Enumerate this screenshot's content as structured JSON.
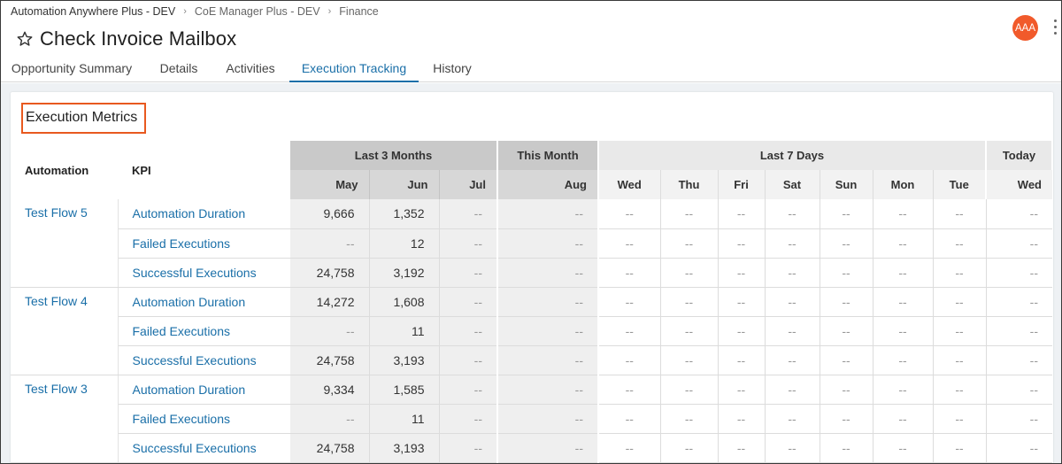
{
  "breadcrumb": [
    "Automation Anywhere Plus - DEV",
    "CoE Manager Plus - DEV",
    "Finance"
  ],
  "title": "Check Invoice Mailbox",
  "user_initials": "AAA",
  "tabs": [
    "Opportunity Summary",
    "Details",
    "Activities",
    "Execution Tracking",
    "History"
  ],
  "active_tab": "Execution Tracking",
  "section_title": "Execution Metrics",
  "columns": {
    "automation": "Automation",
    "kpi": "KPI",
    "group_last3": "Last 3 Months",
    "group_this_month": "This Month",
    "group_last7": "Last 7 Days",
    "group_today": "Today",
    "months": [
      "May",
      "Jun",
      "Jul"
    ],
    "this_month": "Aug",
    "days": [
      "Wed",
      "Thu",
      "Fri",
      "Sat",
      "Sun",
      "Mon",
      "Tue"
    ],
    "today": "Wed"
  },
  "empty": "--",
  "rows": [
    {
      "automation": "Test Flow 5",
      "kpis": [
        {
          "name": "Automation Duration",
          "months": [
            "9,666",
            "1,352",
            "--"
          ]
        },
        {
          "name": "Failed Executions",
          "months": [
            "--",
            "12",
            "--"
          ]
        },
        {
          "name": "Successful Executions",
          "months": [
            "24,758",
            "3,192",
            "--"
          ]
        }
      ]
    },
    {
      "automation": "Test Flow 4",
      "kpis": [
        {
          "name": "Automation Duration",
          "months": [
            "14,272",
            "1,608",
            "--"
          ]
        },
        {
          "name": "Failed Executions",
          "months": [
            "--",
            "11",
            "--"
          ]
        },
        {
          "name": "Successful Executions",
          "months": [
            "24,758",
            "3,193",
            "--"
          ]
        }
      ]
    },
    {
      "automation": "Test Flow 3",
      "kpis": [
        {
          "name": "Automation Duration",
          "months": [
            "9,334",
            "1,585",
            "--"
          ]
        },
        {
          "name": "Failed Executions",
          "months": [
            "--",
            "11",
            "--"
          ]
        },
        {
          "name": "Successful Executions",
          "months": [
            "24,758",
            "3,193",
            "--"
          ]
        }
      ]
    }
  ],
  "colors": {
    "accent": "#1a6fa8",
    "avatar": "#f15a2b",
    "highlight": "#e8591f"
  }
}
